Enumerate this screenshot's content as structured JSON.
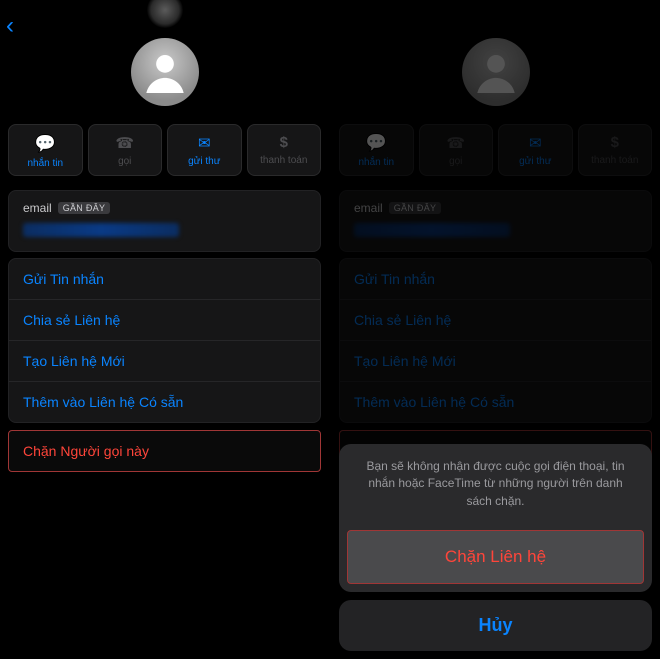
{
  "avatar_alt": "contact avatar",
  "actions": {
    "message": {
      "label": "nhắn tin",
      "class": "active"
    },
    "call": {
      "label": "gọi",
      "class": "dim"
    },
    "mail": {
      "label": "gửi thư",
      "class": "active"
    },
    "pay": {
      "label": "thanh toán",
      "class": "dim"
    }
  },
  "email": {
    "label": "email",
    "badge": "GẦN ĐÂY"
  },
  "rows": {
    "send_message": "Gửi Tin nhắn",
    "share_contact": "Chia sẻ Liên hệ",
    "new_contact": "Tạo Liên hệ Mới",
    "add_existing": "Thêm vào Liên hệ Có sẵn"
  },
  "block_caller": "Chặn Người gọi này",
  "sheet": {
    "message": "Bạn sẽ không nhận được cuộc gọi điện thoại, tin nhắn hoặc FaceTime từ những người trên danh sách chặn.",
    "confirm": "Chặn Liên hệ",
    "cancel": "Hủy"
  }
}
